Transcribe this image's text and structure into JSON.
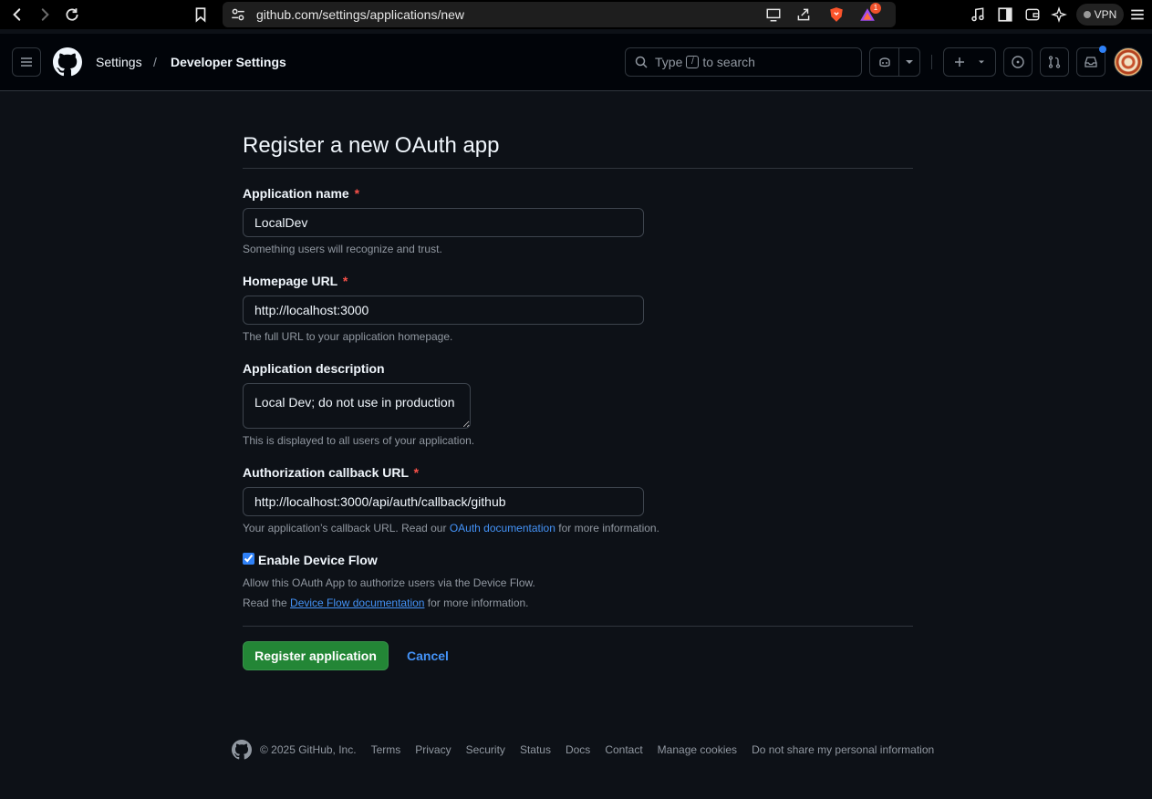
{
  "browser": {
    "url": "github.com/settings/applications/new",
    "brave_notification_count": "1",
    "vpn_label": "VPN"
  },
  "header": {
    "breadcrumb": [
      "Settings",
      "Developer Settings"
    ],
    "breadcrumb_separator": "/",
    "search": {
      "prefix": "Type",
      "key": "/",
      "suffix": "to search"
    }
  },
  "form": {
    "title": "Register a new OAuth app",
    "required_marker": "*",
    "app_name": {
      "label": "Application name",
      "value": "LocalDev",
      "hint": "Something users will recognize and trust."
    },
    "homepage_url": {
      "label": "Homepage URL",
      "value": "http://localhost:3000",
      "hint": "The full URL to your application homepage."
    },
    "description": {
      "label": "Application description",
      "value": "Local Dev; do not use in production",
      "hint": "This is displayed to all users of your application."
    },
    "callback_url": {
      "label": "Authorization callback URL",
      "value": "http://localhost:3000/api/auth/callback/github",
      "hint_prefix": "Your application’s callback URL. Read our",
      "hint_link": "OAuth documentation",
      "hint_suffix": "for more information."
    },
    "device_flow": {
      "label": "Enable Device Flow",
      "checked": true,
      "hint_line1": "Allow this OAuth App to authorize users via the Device Flow.",
      "hint_line2_prefix": "Read the",
      "hint_line2_link": "Device Flow documentation",
      "hint_line2_suffix": "for more information."
    },
    "submit_label": "Register application",
    "cancel_label": "Cancel"
  },
  "footer": {
    "copyright": "© 2025 GitHub, Inc.",
    "links": [
      "Terms",
      "Privacy",
      "Security",
      "Status",
      "Docs",
      "Contact",
      "Manage cookies",
      "Do not share my personal information"
    ]
  },
  "colors": {
    "background": "#0d1117",
    "header_bg": "#010409",
    "primary_button": "#238636",
    "link": "#4493f8",
    "required": "#f85149"
  },
  "icons": [
    "back-arrow-icon",
    "forward-arrow-icon",
    "reload-icon",
    "bookmark-icon",
    "site-info-icon",
    "cast-icon",
    "share-icon",
    "brave-shield-icon",
    "brave-rewards-icon",
    "music-icon",
    "sidebar-icon",
    "wallet-icon",
    "leo-ai-icon",
    "menu-icon",
    "hamburger-icon",
    "github-logo-icon",
    "search-icon",
    "copilot-icon",
    "chevron-down-icon",
    "plus-icon",
    "issues-icon",
    "pull-requests-icon",
    "inbox-icon"
  ]
}
